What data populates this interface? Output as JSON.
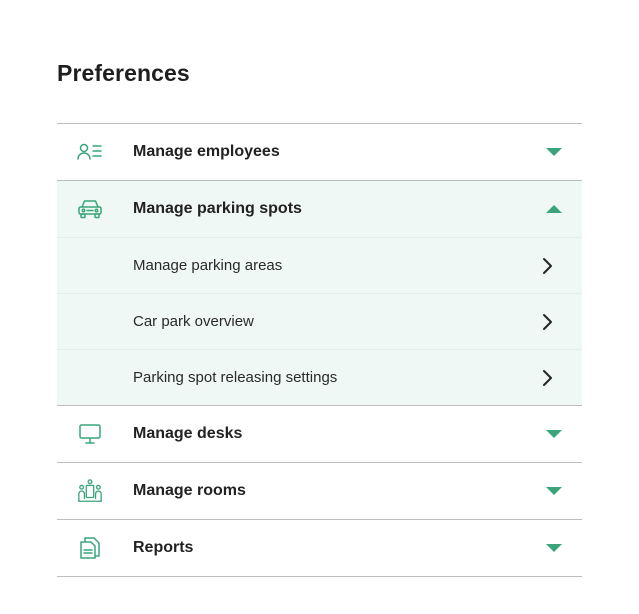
{
  "page": {
    "title": "Preferences"
  },
  "colors": {
    "accent": "#3aa57a",
    "expanded_bg": "#eff8f4",
    "divider": "#bdbdbd"
  },
  "sections": [
    {
      "label": "Manage employees",
      "icon": "employees-list-icon",
      "expanded": false
    },
    {
      "label": "Manage parking spots",
      "icon": "car-icon",
      "expanded": true,
      "items": [
        {
          "label": "Manage parking areas"
        },
        {
          "label": "Car park overview"
        },
        {
          "label": "Parking spot releasing settings"
        }
      ]
    },
    {
      "label": "Manage desks",
      "icon": "monitor-icon",
      "expanded": false
    },
    {
      "label": "Manage rooms",
      "icon": "meeting-room-icon",
      "expanded": false
    },
    {
      "label": "Reports",
      "icon": "document-icon",
      "expanded": false
    }
  ]
}
